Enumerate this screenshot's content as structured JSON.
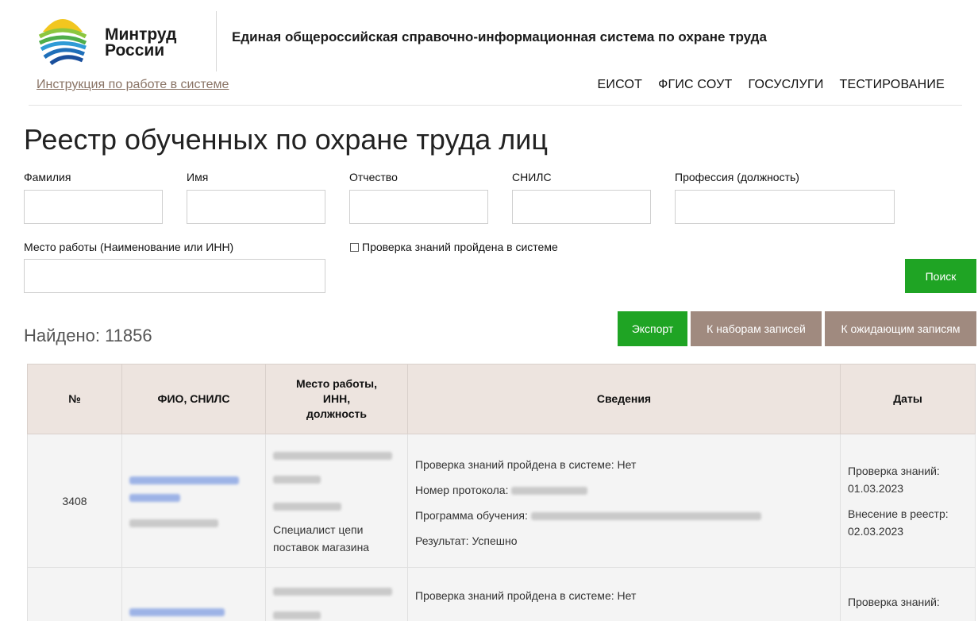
{
  "header": {
    "brand_line1": "Минтруд",
    "brand_line2": "России",
    "system_title": "Единая общероссийская справочно-информационная система по охране труда",
    "instruction_link": "Инструкция по работе в системе",
    "nav": [
      "ЕИСОТ",
      "ФГИС СОУТ",
      "ГОСУСЛУГИ",
      "ТЕСТИРОВАНИЕ"
    ]
  },
  "page": {
    "title": "Реестр обученных по охране труда лиц"
  },
  "filters": {
    "last_name_label": "Фамилия",
    "first_name_label": "Имя",
    "patronymic_label": "Отчество",
    "snils_label": "СНИЛС",
    "profession_label": "Профессия (должность)",
    "workplace_label": "Место работы (Наименование или ИНН)",
    "checkbox_label": "Проверка знаний пройдена в системе",
    "search_button": "Поиск"
  },
  "results": {
    "found_text": "Найдено: 11856",
    "export_button": "Экспорт",
    "to_sets_button": "К наборам записей",
    "to_pending_button": "К ожидающим записям"
  },
  "table": {
    "headers": {
      "num": "№",
      "fio": "ФИО, СНИЛС",
      "work_line1": "Место работы,",
      "work_line2": "ИНН,",
      "work_line3": "должность",
      "info": "Сведения",
      "dates": "Даты"
    },
    "rows": [
      {
        "num": "3408",
        "position": "Специалист цепи поставок магазина",
        "info_check": "Проверка знаний пройдена в системе: Нет",
        "info_protocol": "Номер протокола:",
        "info_program": "Программа обучения:",
        "info_result": "Результат: Успешно",
        "date_check_label": "Проверка знаний:",
        "date_check": "01.03.2023",
        "date_registry_label": "Внесение в реестр:",
        "date_registry": "02.03.2023"
      },
      {
        "info_check": "Проверка знаний пройдена в системе: Нет",
        "date_check_label": "Проверка знаний:"
      }
    ]
  }
}
